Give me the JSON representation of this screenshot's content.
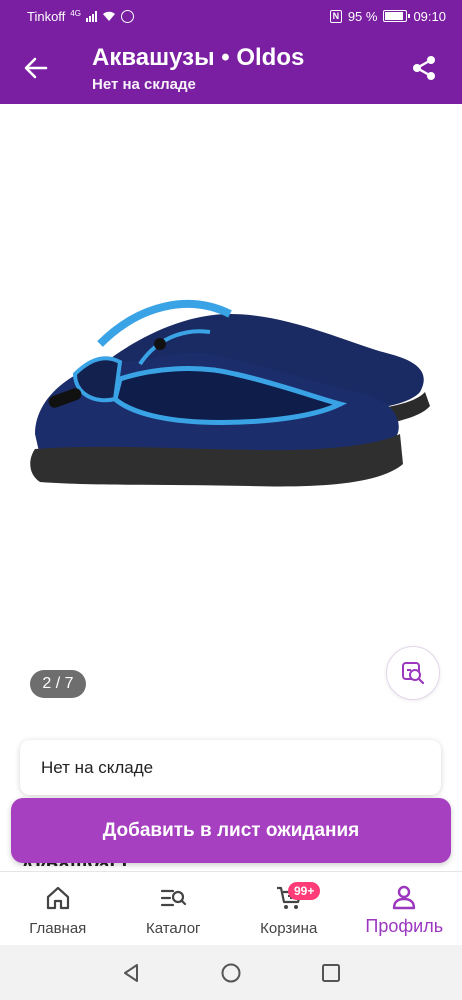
{
  "status_bar": {
    "carrier": "Tinkoff",
    "network": "4G",
    "battery_percent": "95 %",
    "time": "09:10"
  },
  "header": {
    "title": "Аквашузы • Oldos",
    "subtitle": "Нет на складе",
    "back_icon": "arrow-left-icon",
    "share_icon": "share-icon"
  },
  "gallery": {
    "counter": "2 / 7",
    "current": 2,
    "total": 7,
    "visual_search_icon": "image-search-icon"
  },
  "product": {
    "stock_status": "Нет на складе",
    "name": "Аквашузы"
  },
  "actions": {
    "wait_list_label": "Добавить в лист ожидания"
  },
  "bottom_nav": {
    "items": [
      {
        "label": "Главная",
        "icon": "home-icon"
      },
      {
        "label": "Каталог",
        "icon": "catalog-search-icon"
      },
      {
        "label": "Корзина",
        "icon": "cart-icon",
        "badge": "99+"
      },
      {
        "label": "Профиль",
        "icon": "profile-icon",
        "active": true
      }
    ]
  },
  "colors": {
    "brand": "#7a1fa2",
    "button": "#a63fc0",
    "badge": "#ff3b78",
    "active_nav": "#9b36bf"
  }
}
